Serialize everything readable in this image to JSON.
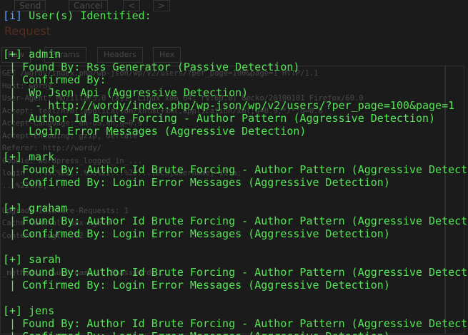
{
  "background_app": {
    "buttons": [
      "Send",
      "Cancel",
      "<",
      ">"
    ],
    "heading": "Request",
    "tabs": [
      "Raw",
      "Params",
      "Headers",
      "Hex"
    ],
    "request_lines": [
      "GET /wordy/index.php/wp-json/wp/v2/users/?per_page=100&page=1 HTTP/1.1",
      "Host: wordy",
      "User-Agent: Mozilla/5.0 (X11; Linux x86_64; rv:60.0) Gecko/20100101 Firefox/60.0",
      "Accept: text/html,application/xhtml+xml,application/xml;q=0.9,*/*;q=0.8",
      "Accept-Language: en-US,en;q=0.5",
      "Accept-Encoding: gzip, deflate",
      "Referer: http://wordy/",
      "Cookie: wordpress_logged_in_...",
      "login_...%5C%22...%5C%22...%22...;ECS[username]=111a;",
      "...%22%7D; ...",
      "",
      "Upgrade-Insecure-Requests: 1",
      "Cache-Control: max-age=0",
      "Content-Length: 72",
      "",
      "",
      "_method=...&username=...&password=..."
    ]
  },
  "terminal": {
    "header": {
      "tag": "[i]",
      "text": " User(s) Identified:"
    },
    "users": [
      {
        "tag": "[+]",
        "name": "admin",
        "lines": [
          " | Found By: Rss Generator (Passive Detection)",
          " | Confirmed By:",
          " |  Wp Json Api (Aggressive Detection)",
          " |   - http://wordy/index.php/wp-json/wp/v2/users/?per_page=100&page=1",
          " |  Author Id Brute Forcing - Author Pattern (Aggressive Detection)",
          " |  Login Error Messages (Aggressive Detection)"
        ]
      },
      {
        "tag": "[+]",
        "name": "mark",
        "lines": [
          " | Found By: Author Id Brute Forcing - Author Pattern (Aggressive Detection)",
          " | Confirmed By: Login Error Messages (Aggressive Detection)"
        ]
      },
      {
        "tag": "[+]",
        "name": "graham",
        "lines": [
          " | Found By: Author Id Brute Forcing - Author Pattern (Aggressive Detection)",
          " | Confirmed By: Login Error Messages (Aggressive Detection)"
        ]
      },
      {
        "tag": "[+]",
        "name": "sarah",
        "lines": [
          " | Found By: Author Id Brute Forcing - Author Pattern (Aggressive Detection)",
          " | Confirmed By: Login Error Messages (Aggressive Detection)"
        ]
      },
      {
        "tag": "[+]",
        "name": "jens",
        "lines": [
          " | Found By: Author Id Brute Forcing - Author Pattern (Aggressive Detection)",
          " | Confirmed By: Login Error Messages (Aggressive Detection)"
        ]
      }
    ]
  },
  "colors": {
    "terminal_text": "#55e655",
    "info_tag": "#5aa0ff",
    "background": "#1b1b1b",
    "ghost_heading": "#ff6a3d"
  }
}
